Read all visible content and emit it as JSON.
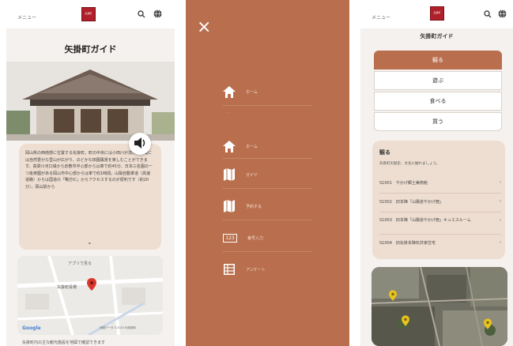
{
  "screen1": {
    "menu_label": "メニュー",
    "logo_text": "矢掛町",
    "title": "矢掛町ガイド",
    "description": "岡山県の西南部に位置する矢掛町。町の中央には小田川が流れ、町域には自然豊かな里山が広がり、のどかな田園風景を楽しむことができます。高梁川河口域から倉敷市中心部からは車で約45分、日本三名園の一つ後楽園がある岡山市中心部からは車で約1時間。山陽自動車道（高速道路）からは国道の「鴨方IC」からアクセスするのが便利です（約20分）。岡山駅から",
    "map_directions": "アプリで見る",
    "map_pin_label": "矢掛町役場",
    "map_google": "Google",
    "map_attribution": "地図データ ©2023 利用規約",
    "bottom_text": "矢掛町内の主な観光施設を地図で確認できます"
  },
  "screen2": {
    "close_icon": "×",
    "items": [
      {
        "icon": "home",
        "label": "ホーム"
      },
      {
        "icon": "home",
        "label": "ホーム"
      },
      {
        "icon": "map",
        "label": "ガイド"
      },
      {
        "icon": "map",
        "label": "予約する"
      },
      {
        "icon": "number",
        "label": "番号入力",
        "badge": "123"
      },
      {
        "icon": "list",
        "label": "アンケート"
      }
    ],
    "divider_text": "- -"
  },
  "screen3": {
    "menu_label": "メニュー",
    "logo_text": "矢掛町",
    "title": "矢掛町ガイド",
    "tabs": [
      "観る",
      "遊ぶ",
      "食べる",
      "買う"
    ],
    "active_tab": 0,
    "section_title": "観る",
    "section_desc": "矢掛町の歴史、文化に触れましょう。",
    "list": [
      {
        "code": "S1001",
        "name": "やかげ郷土美術館"
      },
      {
        "code": "S1002",
        "name": "旧本陣「山陽道やかげ宿」"
      },
      {
        "code": "S1003",
        "name": "旧本陣「山陽道やかげ宿」キュエスルーム"
      },
      {
        "code": "S1004",
        "name": "旧矢掛本陣石井家住宅"
      }
    ],
    "chevron": "›"
  },
  "colors": {
    "brand": "#b96f4d",
    "card": "#eeded1",
    "logo": "#b0202a"
  }
}
